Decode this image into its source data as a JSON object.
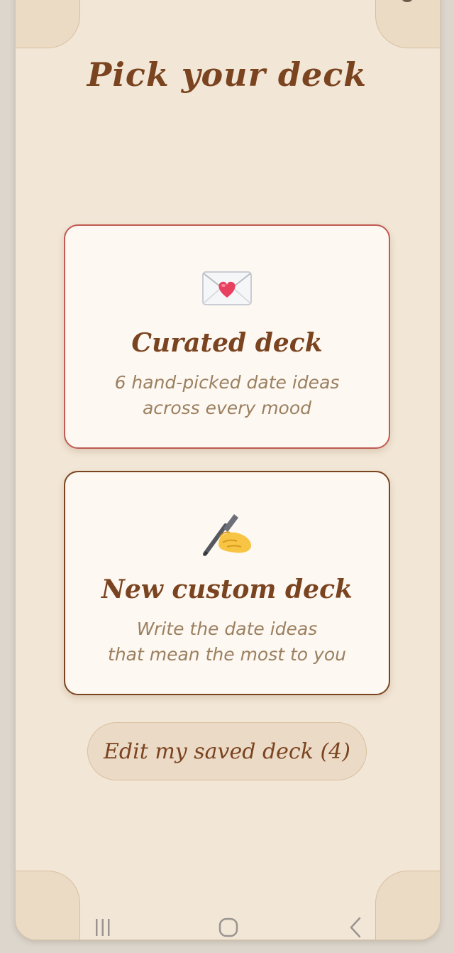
{
  "colors": {
    "background": "#f2e6d6",
    "corner_accent": "#ebdac4",
    "primary_brown": "#7b4420",
    "curated_border": "#c05a52",
    "description_text": "#9b8060",
    "card_background": "#fdf8f2"
  },
  "header": {
    "title": "Pick your deck"
  },
  "cards": [
    {
      "id": "curated",
      "icon": "love-letter-icon",
      "title": "Curated deck",
      "description_line1": "6 hand-picked date ideas",
      "description_line2": "across every mood"
    },
    {
      "id": "custom",
      "icon": "writing-hand-icon",
      "title": "New custom deck",
      "description_line1": "Write the date ideas",
      "description_line2": "that mean the most to you"
    }
  ],
  "edit_button": {
    "label": "Edit my saved deck (4)"
  },
  "navigation": {
    "items": [
      "recent-apps-icon",
      "home-icon",
      "back-icon"
    ]
  }
}
